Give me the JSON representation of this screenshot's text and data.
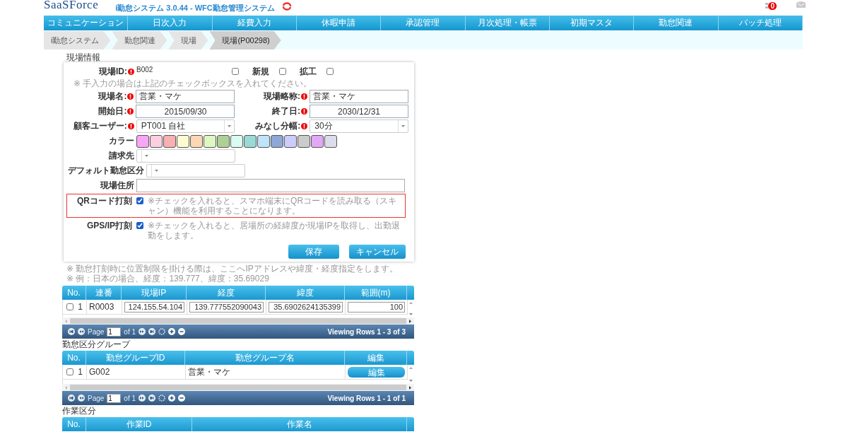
{
  "header": {
    "logo": "SaaSForce",
    "title": "i勤怠システム 3.0.44 - WFC勤怠管理システム",
    "notification_count": "0"
  },
  "nav": [
    "コミュニケーション",
    "日次入力",
    "経費入力",
    "休暇申請",
    "承認管理",
    "月次処理・帳票",
    "初期マスタ",
    "勤怠関連",
    "バッチ処理"
  ],
  "breadcrumb": [
    {
      "label": "i勤怠システム",
      "selected": false
    },
    {
      "label": "勤怠関連",
      "selected": false
    },
    {
      "label": "現場",
      "selected": false
    },
    {
      "label": "現場(P00298)",
      "selected": true
    }
  ],
  "form": {
    "legend": "現場情報",
    "site_id": {
      "label": "現場ID:",
      "value": "B002"
    },
    "id_checks": [
      {
        "checked": false
      },
      {
        "label": "新規",
        "checked": false
      },
      {
        "label": "拡工",
        "checked": false
      }
    ],
    "hint": "※ 手入力の場合は上記のチェックボックスを入れてください。",
    "pairs": [
      [
        {
          "label": "現場名:",
          "kind": "text",
          "value": "営業・マケ",
          "required": true
        },
        {
          "label": "現場略称:",
          "kind": "text",
          "value": "営業・マケ",
          "required": true
        }
      ],
      [
        {
          "label": "開始日:",
          "kind": "date",
          "value": "2015/09/30",
          "required": true
        },
        {
          "label": "終了日:",
          "kind": "date",
          "value": "2030/12/31",
          "required": true
        }
      ],
      [
        {
          "label": "顧客ユーザー:",
          "kind": "select",
          "value": "PT001 自社",
          "required": true
        },
        {
          "label": "みなし分幅:",
          "kind": "select",
          "value": "30分",
          "required": true
        }
      ]
    ],
    "color_label": "カラー",
    "colors": [
      {
        "color": "#f7a6f5",
        "selected": false
      },
      {
        "color": "#fbcfe0",
        "selected": false
      },
      {
        "color": "#f8b0b3",
        "selected": false
      },
      {
        "color": "#fdfbcf",
        "selected": false
      },
      {
        "color": "#fbd7b4",
        "selected": false
      },
      {
        "color": "#ddf8c0",
        "selected": false
      },
      {
        "color": "#aed096",
        "selected": false
      },
      {
        "color": "#d9fbf1",
        "selected": false
      },
      {
        "color": "#9bd9d4",
        "selected": false
      },
      {
        "color": "#bfe3fb",
        "selected": false
      },
      {
        "color": "#8ea6d8",
        "selected": false
      },
      {
        "color": "#cdcdfb",
        "selected": false
      },
      {
        "color": "#cbcbcb",
        "selected": false
      },
      {
        "color": "#e1a8f8",
        "selected": false
      },
      {
        "color": "#dcdde9",
        "selected": false
      }
    ],
    "billing": {
      "label": "請求先"
    },
    "default_category": {
      "label": "デフォルト勤怠区分"
    },
    "address": {
      "label": "現場住所"
    },
    "options": [
      {
        "label": "QRコード打刻",
        "checked": true,
        "highlighted": true,
        "note": "※チェックを入れると、スマホ端末にQRコードを読み取る（スキャン）機能を利用することになります。"
      },
      {
        "label": "GPS/IP打刻",
        "checked": true,
        "highlighted": false,
        "note": "※チェックを入れると、居場所の経緯度か現場IPを取得し、出勤退勤をします。"
      }
    ],
    "buttons": [
      "保存",
      "キャンセル"
    ]
  },
  "notes": [
    "※ 勤怠打刻時に位置制限を掛ける際は、ここへIPアドレスや緯度・経度指定をします。",
    "※ 例：日本の場合、経度：139.777、緯度：35.69029"
  ],
  "tables": [
    {
      "columns": [
        "No.",
        "連番",
        "現場IP",
        "経度",
        "緯度",
        "範囲(m)"
      ],
      "rows": [
        {
          "checked": false,
          "cells": [
            {
              "kind": "num",
              "value": "1"
            },
            {
              "kind": "text",
              "value": "R0003"
            },
            {
              "kind": "input",
              "value": "124.155.54.104"
            },
            {
              "kind": "input",
              "value": "139.777552090043"
            },
            {
              "kind": "input",
              "value": "35.6902624135399"
            },
            {
              "kind": "input",
              "value": "100"
            }
          ]
        }
      ],
      "pager": {
        "page_label": "Page",
        "page": "1",
        "of": "of 1",
        "viewing": "Viewing Rows 1 - 3 of 3"
      }
    },
    {
      "title": "勤怠区分グループ",
      "columns": [
        "No.",
        "勤怠グループID",
        "勤怠グループ名",
        "編集"
      ],
      "rows": [
        {
          "checked": false,
          "cells": [
            {
              "kind": "num",
              "value": "1"
            },
            {
              "kind": "text",
              "value": "G002"
            },
            {
              "kind": "text",
              "value": "営業・マケ"
            },
            {
              "kind": "button",
              "value": "編集"
            }
          ]
        }
      ],
      "pager": {
        "page_label": "Page",
        "page": "1",
        "of": "of 1",
        "viewing": "Viewing Rows 1 - 1 of 1"
      }
    },
    {
      "title": "作業区分",
      "columns": [
        "No.",
        "作業ID",
        "作業名"
      ]
    }
  ]
}
